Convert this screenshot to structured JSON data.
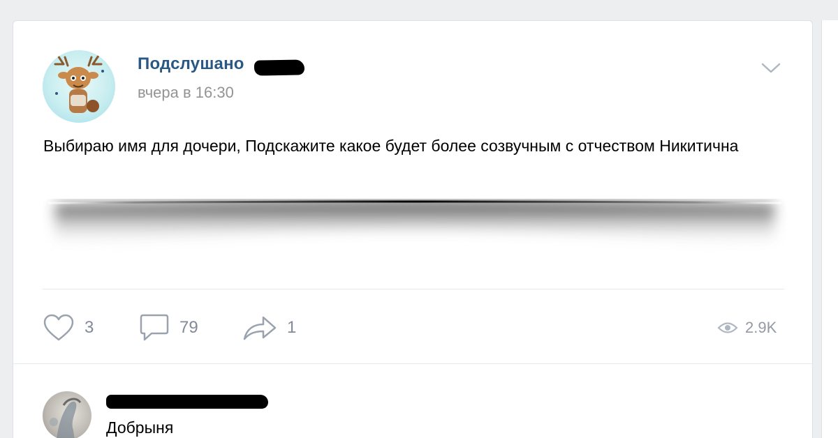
{
  "post": {
    "author": "Подслушано",
    "timestamp": "вчера в 16:30",
    "text": "Выбираю имя для дочери, Подскажите какое будет более созвучным с отчеством Никитична"
  },
  "actions": {
    "likes": "3",
    "comments": "79",
    "shares": "1",
    "views": "2.9K"
  },
  "comment": {
    "text": "Добрыня"
  },
  "icons": {
    "like": "heart-icon",
    "comment": "comment-bubble-icon",
    "share": "share-arrow-icon",
    "views": "eye-icon",
    "menu": "chevron-down-icon"
  },
  "colors": {
    "author_link": "#2a5885",
    "muted_text": "#939393",
    "action_icon": "#828a99",
    "background": "#edeef0"
  }
}
